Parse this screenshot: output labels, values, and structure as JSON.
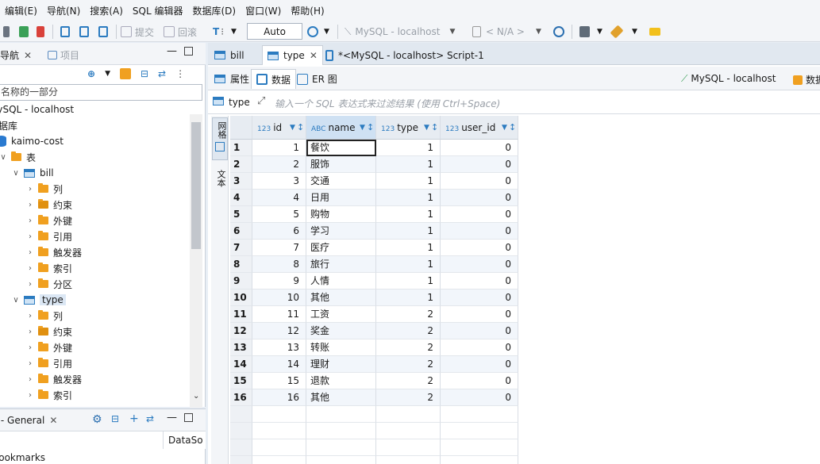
{
  "menubar": [
    "编辑(E)",
    "导航(N)",
    "搜索(A)",
    "SQL 编辑器",
    "数据库(D)",
    "窗口(W)",
    "帮助(H)"
  ],
  "toolbar": {
    "commit": "提交",
    "rollback": "回滚",
    "transaction_mode": "Auto",
    "connection": "MySQL - localhost",
    "schema": "< N/A >"
  },
  "left_panel": {
    "tab_navigator": "库导航",
    "tab_projects": "项目",
    "filter_placeholder": "名称的一部分",
    "tree": [
      {
        "label": "MySQL - localhost",
        "level": 0,
        "icon": "none"
      },
      {
        "label": "数据库",
        "level": 0,
        "icon": "none"
      },
      {
        "label": "kaimo-cost",
        "level": 0,
        "icon": "database-icon"
      },
      {
        "label": "表",
        "level": 1,
        "icon": "table-folder-icon"
      },
      {
        "label": "bill",
        "level": 2,
        "icon": "table-icon"
      },
      {
        "label": "列",
        "level": 3,
        "icon": "folder-icon"
      },
      {
        "label": "约束",
        "level": 3,
        "icon": "constraint-icon"
      },
      {
        "label": "外键",
        "level": 3,
        "icon": "folder-icon"
      },
      {
        "label": "引用",
        "level": 3,
        "icon": "folder-icon"
      },
      {
        "label": "触发器",
        "level": 3,
        "icon": "folder-icon"
      },
      {
        "label": "索引",
        "level": 3,
        "icon": "folder-icon"
      },
      {
        "label": "分区",
        "level": 3,
        "icon": "folder-icon"
      },
      {
        "label": "type",
        "level": 2,
        "icon": "table-icon"
      },
      {
        "label": "列",
        "level": 3,
        "icon": "folder-icon"
      },
      {
        "label": "约束",
        "level": 3,
        "icon": "constraint-icon"
      },
      {
        "label": "外键",
        "level": 3,
        "icon": "folder-icon"
      },
      {
        "label": "引用",
        "level": 3,
        "icon": "folder-icon"
      },
      {
        "label": "触发器",
        "level": 3,
        "icon": "folder-icon"
      },
      {
        "label": "索引",
        "level": 3,
        "icon": "folder-icon"
      }
    ]
  },
  "bottom_panel": {
    "tab_label": "Project - General",
    "column_header": "DataSo",
    "item": "Bookmarks"
  },
  "editor": {
    "tabs": [
      "bill",
      "type",
      "*<MySQL - localhost> Script-1"
    ],
    "subtabs": [
      "属性",
      "数据",
      "ER 图"
    ],
    "connection_label": "MySQL - localhost",
    "db_label": "数据",
    "filter_table": "type",
    "filter_placeholder": "输入一个 SQL 表达式来过滤结果 (使用 Ctrl+Space)",
    "side_grid": "网格",
    "side_text": "文本",
    "columns": [
      {
        "type": "123",
        "name": "id"
      },
      {
        "type": "ABC",
        "name": "name"
      },
      {
        "type": "123",
        "name": "type"
      },
      {
        "type": "123",
        "name": "user_id"
      }
    ],
    "rows": [
      [
        "1",
        "1",
        "餐饮",
        "1",
        "0"
      ],
      [
        "2",
        "2",
        "服饰",
        "1",
        "0"
      ],
      [
        "3",
        "3",
        "交通",
        "1",
        "0"
      ],
      [
        "4",
        "4",
        "日用",
        "1",
        "0"
      ],
      [
        "5",
        "5",
        "购物",
        "1",
        "0"
      ],
      [
        "6",
        "6",
        "学习",
        "1",
        "0"
      ],
      [
        "7",
        "7",
        "医疗",
        "1",
        "0"
      ],
      [
        "8",
        "8",
        "旅行",
        "1",
        "0"
      ],
      [
        "9",
        "9",
        "人情",
        "1",
        "0"
      ],
      [
        "10",
        "10",
        "其他",
        "1",
        "0"
      ],
      [
        "11",
        "11",
        "工资",
        "2",
        "0"
      ],
      [
        "12",
        "12",
        "奖金",
        "2",
        "0"
      ],
      [
        "13",
        "13",
        "转账",
        "2",
        "0"
      ],
      [
        "14",
        "14",
        "理财",
        "2",
        "0"
      ],
      [
        "15",
        "15",
        "退款",
        "2",
        "0"
      ],
      [
        "16",
        "16",
        "其他",
        "2",
        "0"
      ]
    ]
  }
}
